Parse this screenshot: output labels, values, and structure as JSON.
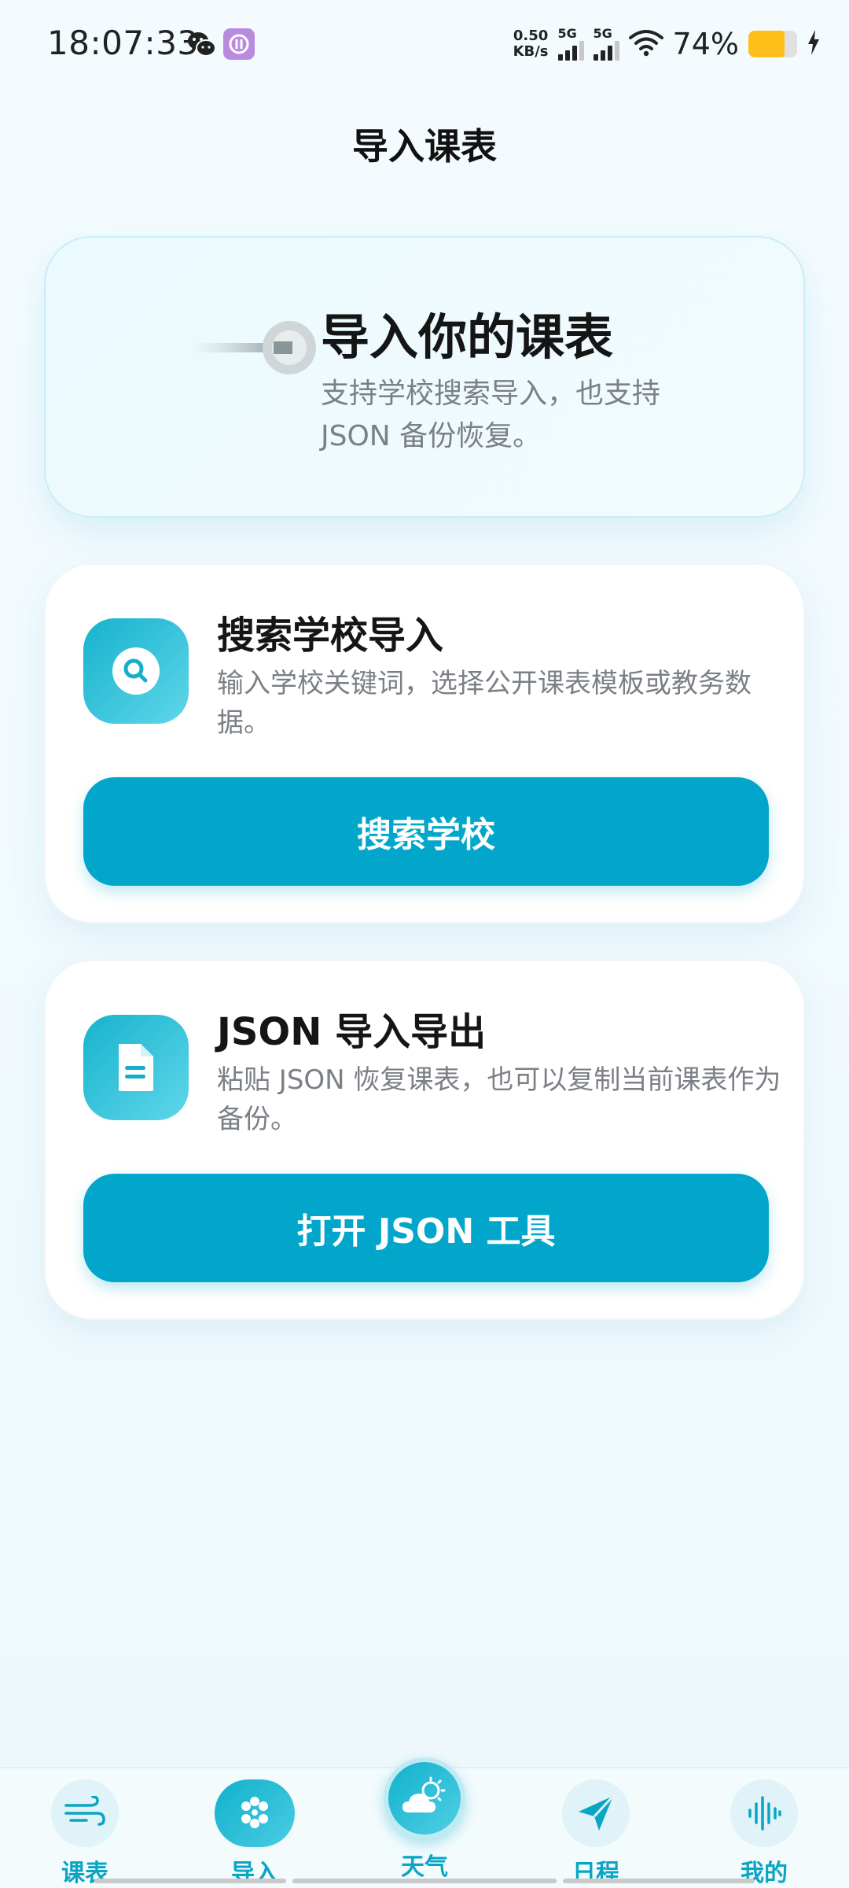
{
  "status_bar": {
    "time": "18:07:33",
    "net_speed_value": "0.50",
    "net_speed_unit": "KB/s",
    "sim1_label": "5G",
    "sim2_label": "5G",
    "battery_text": "74%",
    "battery_level": 0.74,
    "icons": [
      "wechat-icon",
      "app-notification-icon",
      "wifi-icon",
      "battery-icon",
      "charging-icon"
    ]
  },
  "header": {
    "title": "导入课表"
  },
  "hero": {
    "title": "导入你的课表",
    "description": "支持学校搜索导入，也支持 JSON 备份恢复。",
    "icon": "import-motion-icon"
  },
  "cards": {
    "search": {
      "title": "搜索学校导入",
      "description": "输入学校关键词，选择公开课表模板或教务数据。",
      "button_label": "搜索学校",
      "icon": "search-icon"
    },
    "json": {
      "title": "JSON 导入导出",
      "description": "粘贴 JSON 恢复课表，也可以复制当前课表作为备份。",
      "button_label": "打开 JSON 工具",
      "icon": "document-icon"
    }
  },
  "nav": {
    "items": [
      {
        "label": "课表",
        "icon": "wind-icon"
      },
      {
        "label": "导入",
        "icon": "dots-grid-icon"
      },
      {
        "label": "天气",
        "icon": "weather-icon"
      },
      {
        "label": "日程",
        "icon": "send-icon"
      },
      {
        "label": "我的",
        "icon": "soundwave-icon"
      }
    ],
    "active_index": 1
  },
  "colors": {
    "accent": "#03A6CB",
    "nav_text": "#0AA5C4",
    "battery": "#FFBF1A"
  }
}
